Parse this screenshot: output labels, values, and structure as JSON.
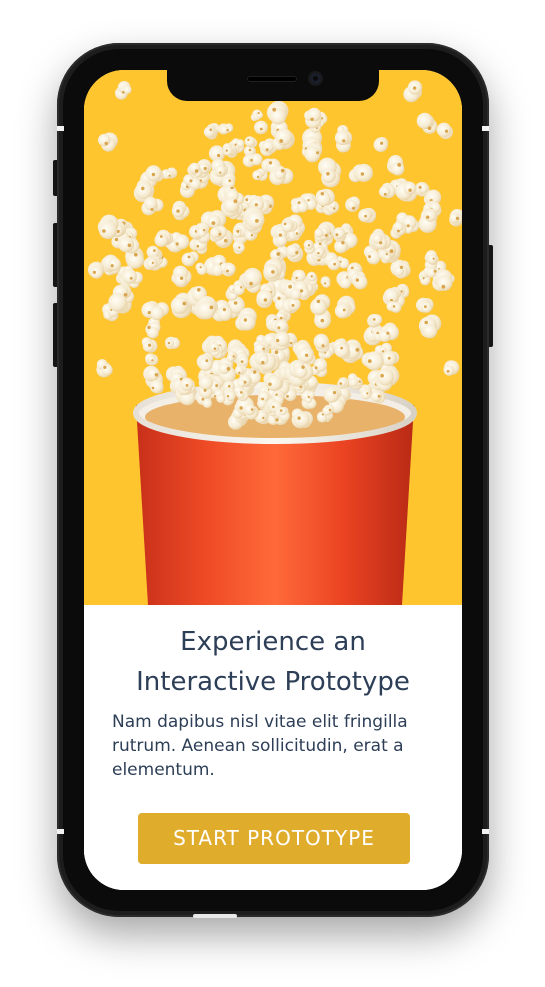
{
  "content": {
    "title_line1": "Experience an",
    "title_line2": "Interactive Prototype",
    "body": "Nam dapibus nisl vitae elit fringilla rutrum. Aenean sollicitudin, erat a elementum.",
    "cta_label": "START PROTOTYPE"
  },
  "hero": {
    "image_description_icon": "popcorn-cup-image"
  },
  "colors": {
    "hero_background": "#fec52e",
    "cup_red": "#e8401f",
    "text": "#2d3e57",
    "button": "#e0ac2c",
    "phone_frame": "#1d1d1d"
  }
}
